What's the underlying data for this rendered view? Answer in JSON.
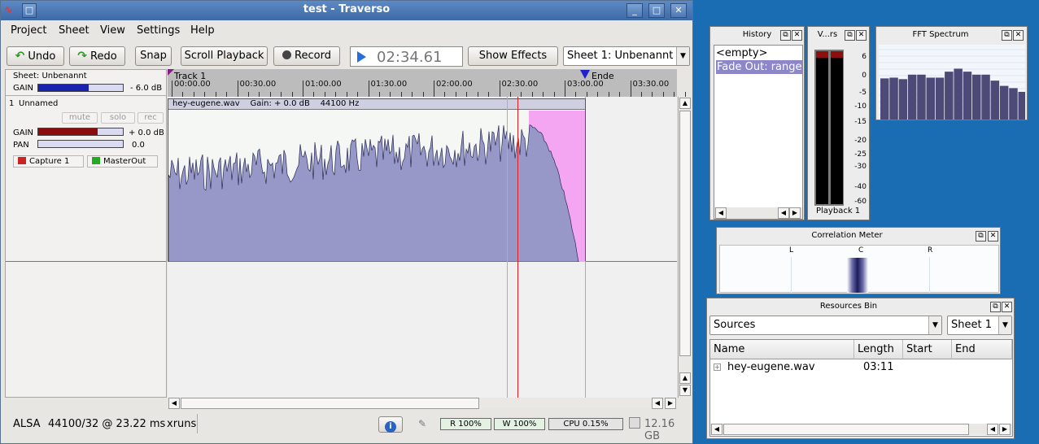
{
  "window": {
    "title": "test - Traverso"
  },
  "menu": [
    "Project",
    "Sheet",
    "View",
    "Settings",
    "Help"
  ],
  "toolbar": {
    "undo": "Undo",
    "redo": "Redo",
    "snap": "Snap",
    "scroll_playback": "Scroll Playback",
    "record": "Record",
    "time": "02:34.61",
    "show_effects": "Show Effects",
    "sheet_select": "Sheet 1: Unbenannt"
  },
  "sheet": {
    "label": "Sheet: Unbenannt",
    "gain_label": "GAIN",
    "gain_value": "- 6.0 dB",
    "gain_level": 0.6
  },
  "track": {
    "number": "1",
    "name": "Unnamed",
    "mute": "mute",
    "solo": "solo",
    "rec": "rec",
    "gain_label": "GAIN",
    "gain_value": "+ 0.0 dB",
    "gain_level": 0.7,
    "pan_label": "PAN",
    "pan_value": "0.0",
    "capture": "Capture 1",
    "output": "MasterOut"
  },
  "ruler": {
    "track_marker": "Track 1",
    "end_marker": "Ende",
    "ticks": [
      "00:00.00",
      "00:30.00",
      "01:00.00",
      "01:30.00",
      "02:00.00",
      "02:30.00",
      "03:00.00",
      "03:30.00"
    ]
  },
  "clip": {
    "filename": "hey-eugene.wav",
    "gain": "Gain: + 0.0 dB",
    "rate": "44100 Hz"
  },
  "status": {
    "driver": "ALSA",
    "rate": "44100/32 @ 23.22 ms",
    "xruns": "xruns",
    "read": "R 100%",
    "write": "W 100%",
    "cpu": "CPU 0.15%",
    "disk": "12.16 GB"
  },
  "history": {
    "title": "History",
    "items": [
      "<empty>",
      "Fade Out: range"
    ]
  },
  "vu": {
    "title": "V...rs",
    "label": "Playback 1",
    "scale": [
      "6",
      "0",
      "-5",
      "-10",
      "-15",
      "-20",
      "-25",
      "-30",
      "-40",
      "-60"
    ]
  },
  "fft": {
    "title": "FFT Spectrum",
    "levels": [
      0.55,
      0.56,
      0.54,
      0.6,
      0.6,
      0.56,
      0.56,
      0.64,
      0.68,
      0.64,
      0.6,
      0.6,
      0.52,
      0.45,
      0.42,
      0.37
    ]
  },
  "correlation": {
    "title": "Correlation Meter",
    "left": "L",
    "center": "C",
    "right": "R"
  },
  "resources": {
    "title": "Resources Bin",
    "source_select": "Sources",
    "sheet_select": "Sheet 1",
    "columns": [
      "Name",
      "Length",
      "Start",
      "End"
    ],
    "rows": [
      {
        "name": "hey-eugene.wav",
        "length": "03:11",
        "start": "",
        "end": ""
      }
    ]
  },
  "colors": {
    "accent": "#4a72b0",
    "wave": "#9898c8",
    "fade": "#f5a6f3",
    "playhead": "#e02020"
  }
}
